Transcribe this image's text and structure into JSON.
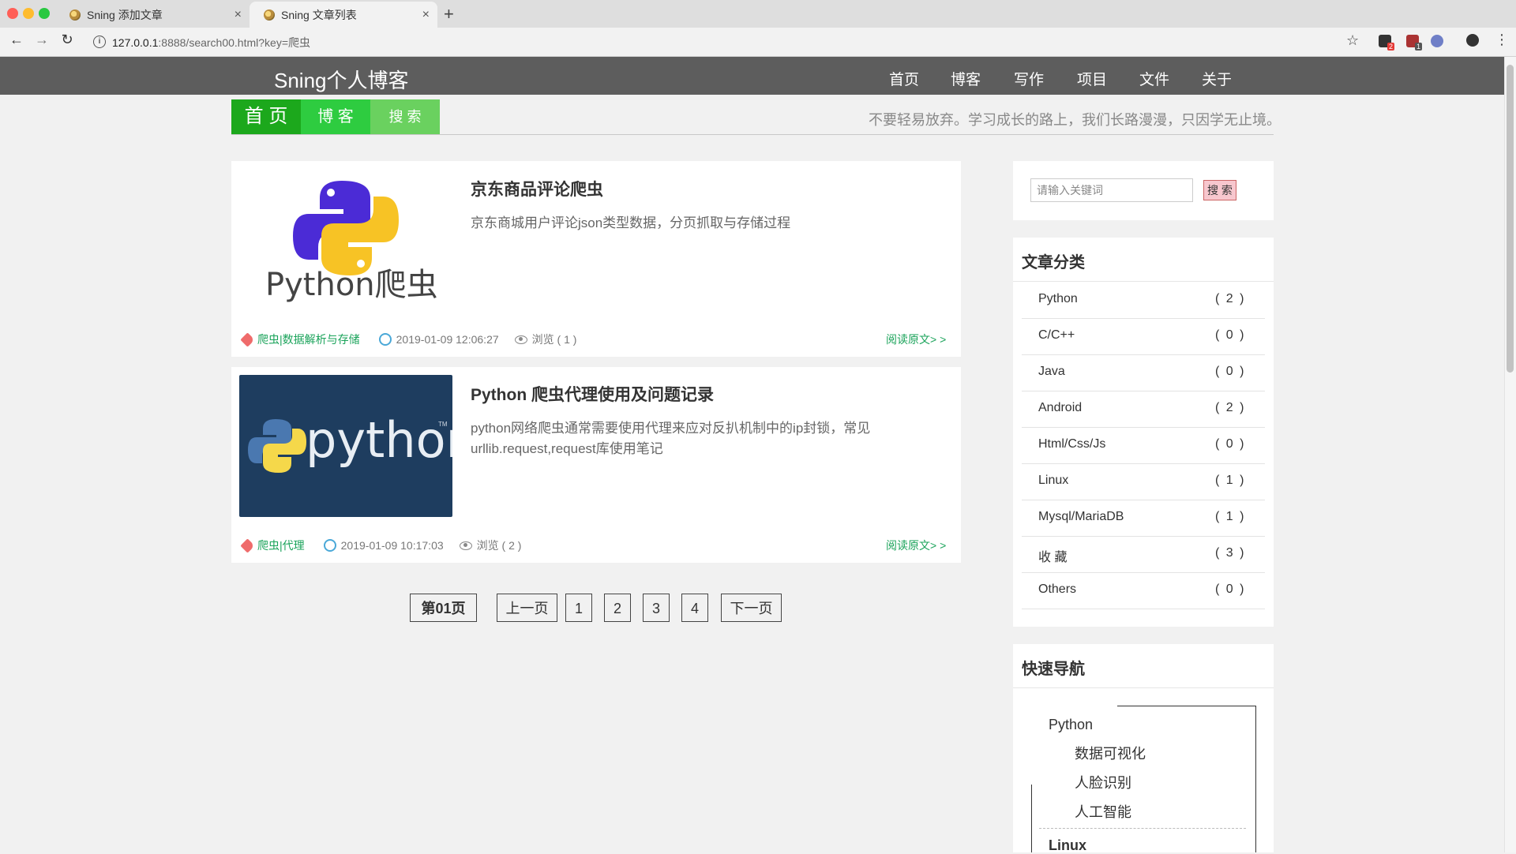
{
  "browser": {
    "tabs": [
      {
        "title": "Sning 添加文章",
        "active": false
      },
      {
        "title": "Sning 文章列表",
        "active": true
      }
    ],
    "new_tab": "+",
    "close_glyph": "×",
    "url_host": "127.0.0.1",
    "url_rest": ":8888/search00.html?key=爬虫",
    "ext_badges": [
      "2",
      "1"
    ]
  },
  "site": {
    "title": "Sning个人博客",
    "nav": [
      "首页",
      "博客",
      "写作",
      "项目",
      "文件",
      "关于"
    ],
    "subtabs": [
      "首 页",
      "博 客",
      "搜 索"
    ],
    "motto": "不要轻易放弃。学习成长的路上，我们长路漫漫，只因学无止境。"
  },
  "articles": [
    {
      "thumb_text": "Python爬虫",
      "title": "京东商品评论爬虫",
      "desc": "京东商城用户评论json类型数据，分页抓取与存储过程",
      "tags": "爬虫|数据解析与存储",
      "date": "2019-01-09 12:06:27",
      "views": "浏览 ( 1 )",
      "read_more": "阅读原文> >"
    },
    {
      "thumb_text": "python",
      "thumb_tm": "TM",
      "title": "Python 爬虫代理使用及问题记录",
      "desc": "python网络爬虫通常需要使用代理来应对反扒机制中的ip封锁，常见urllib.request,request库使用笔记",
      "tags": "爬虫|代理",
      "date": "2019-01-09 10:17:03",
      "views": "浏览 ( 2 )",
      "read_more": "阅读原文> >"
    }
  ],
  "pagination": {
    "current": "第01页",
    "prev": "上一页",
    "pages": [
      "1",
      "2",
      "3",
      "4"
    ],
    "next": "下一页"
  },
  "sidebar": {
    "search": {
      "placeholder": "请输入关键词",
      "button": "搜 索"
    },
    "categories_title": "文章分类",
    "categories": [
      {
        "name": "Python",
        "count": "( 2 )"
      },
      {
        "name": "C/C++",
        "count": "( 0 )"
      },
      {
        "name": "Java",
        "count": "( 0 )"
      },
      {
        "name": "Android",
        "count": "( 2 )"
      },
      {
        "name": "Html/Css/Js",
        "count": "( 0 )"
      },
      {
        "name": "Linux",
        "count": "( 1 )"
      },
      {
        "name": "Mysql/MariaDB",
        "count": "( 1 )"
      },
      {
        "name": "收 藏",
        "count": "( 3 )"
      },
      {
        "name": "Others",
        "count": "( 0 )"
      }
    ],
    "quick_nav_title": "快速导航",
    "quick_nav": {
      "group1": "Python",
      "group1_items": [
        "数据可视化",
        "人脸识别",
        "人工智能"
      ],
      "group2": "Linux"
    }
  },
  "colors": {
    "header_bg": "#5d5d5d",
    "subtab_home": "#1ca81c",
    "subtab_blog": "#2ecc40",
    "subtab_search": "#6ad15f",
    "link_green": "#1aa35a",
    "thumb2_bg": "#1e3d5f"
  }
}
